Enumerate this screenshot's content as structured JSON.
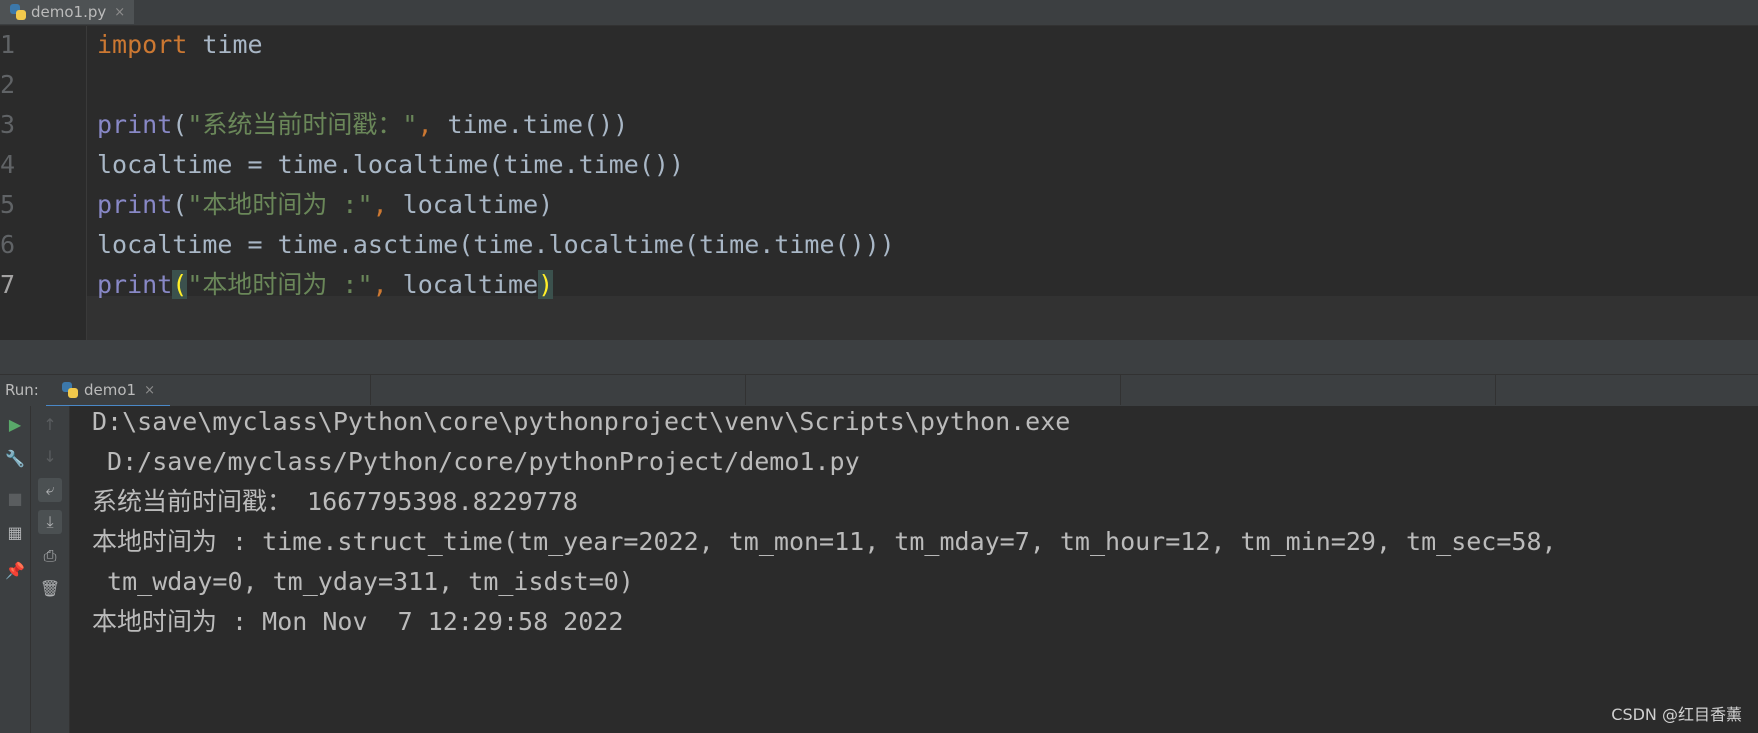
{
  "editor_tab": {
    "filename": "demo1.py",
    "close": "×"
  },
  "editor": {
    "line_numbers": [
      "1",
      "2",
      "3",
      "4",
      "5",
      "6",
      "7"
    ],
    "lines": {
      "l1": {
        "kw": "import",
        "rest": " time"
      },
      "l3": {
        "fn": "print",
        "open": "(",
        "str": "\"系统当前时间戳：\"",
        "comma": ",",
        "rest": " time.time())"
      },
      "l4": {
        "text": "localtime = time.localtime(time.time())"
      },
      "l5": {
        "fn": "print",
        "open": "(",
        "str": "\"本地时间为 :\"",
        "comma": ",",
        "rest": " localtime)"
      },
      "l6": {
        "text": "localtime = time.asctime(time.localtime(time.time()))"
      },
      "l7": {
        "fn": "print",
        "open": "(",
        "str": "\"本地时间为 :\"",
        "comma": ",",
        "rest": " localtime",
        "close": ")"
      }
    }
  },
  "run_panel": {
    "label": "Run:",
    "tab_name": "demo1",
    "close": "×"
  },
  "console": {
    "lines": [
      "D:\\save\\myclass\\Python\\core\\pythonproject\\venv\\Scripts\\python.exe",
      " D:/save/myclass/Python/core/pythonProject/demo1.py",
      "系统当前时间戳： 1667795398.8229778",
      "本地时间为 : time.struct_time(tm_year=2022, tm_mon=11, tm_mday=7, tm_hour=12, tm_min=29, tm_sec=58,",
      " tm_wday=0, tm_yday=311, tm_isdst=0)",
      "本地时间为 : Mon Nov  7 12:29:58 2022"
    ]
  },
  "watermark": "CSDN @红目香薰",
  "icons": [
    "python-file-icon",
    "run-icon",
    "wrench-icon",
    "stop-icon",
    "layout-icon",
    "pin-icon",
    "arrow-up-icon",
    "arrow-down-icon",
    "soft-wrap-icon",
    "scroll-to-end-icon",
    "print-icon",
    "trash-icon"
  ]
}
